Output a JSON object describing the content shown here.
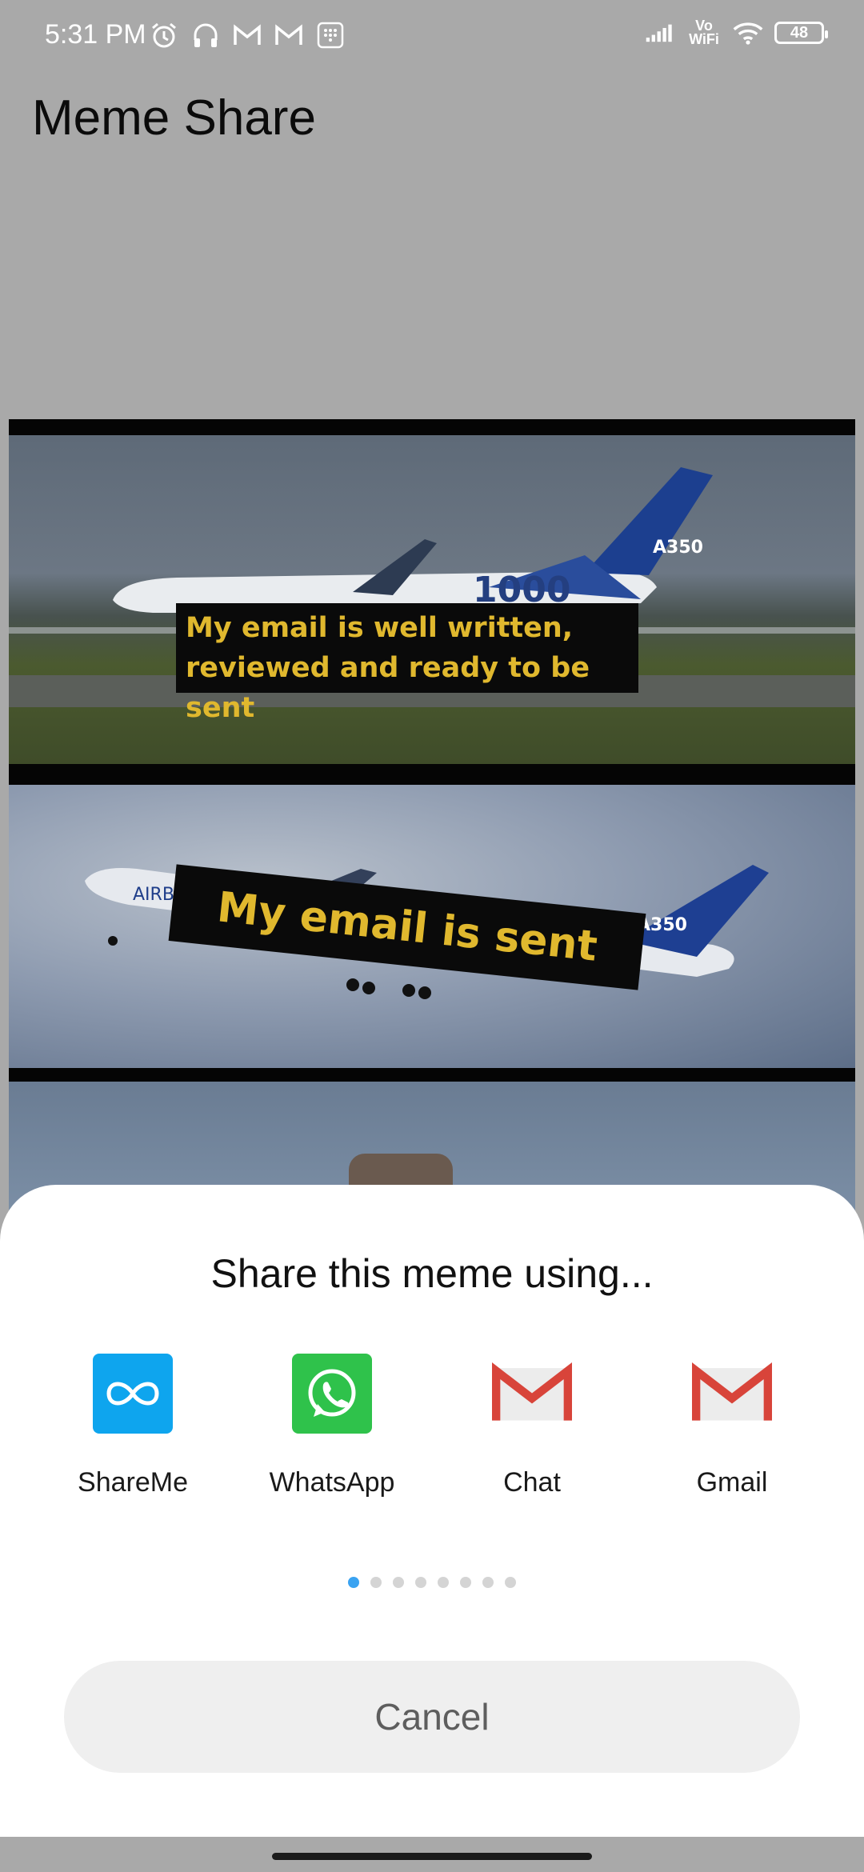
{
  "status_bar": {
    "time": "5:31 PM",
    "left_icons": [
      "alarm-icon",
      "headphones-icon",
      "gmail-notification-icon",
      "gmail-notification-icon",
      "dialpad-icon"
    ],
    "signal_label": "Vo WiFi",
    "battery": "48"
  },
  "app": {
    "title": "Meme Share"
  },
  "meme": {
    "caption_top": "My email is well written, reviewed and ready to be sent",
    "caption_middle": "My email is sent",
    "tail_text_top": "A350",
    "tail_text_middle": "A350",
    "fuselage_text_top": "1000",
    "fuselage_text_middle": "AIRB"
  },
  "share_sheet": {
    "title": "Share this meme using...",
    "apps": [
      {
        "label": "ShareMe",
        "icon": "shareme-icon"
      },
      {
        "label": "WhatsApp",
        "icon": "whatsapp-icon"
      },
      {
        "label": "Chat",
        "icon": "gmail-icon"
      },
      {
        "label": "Gmail",
        "icon": "gmail-icon"
      }
    ],
    "page_count": 8,
    "current_page": 1,
    "cancel_label": "Cancel"
  },
  "colors": {
    "dim_background": "#a9a9a9",
    "caption_text": "#e0b82e",
    "active_dot": "#3aa3f1"
  }
}
